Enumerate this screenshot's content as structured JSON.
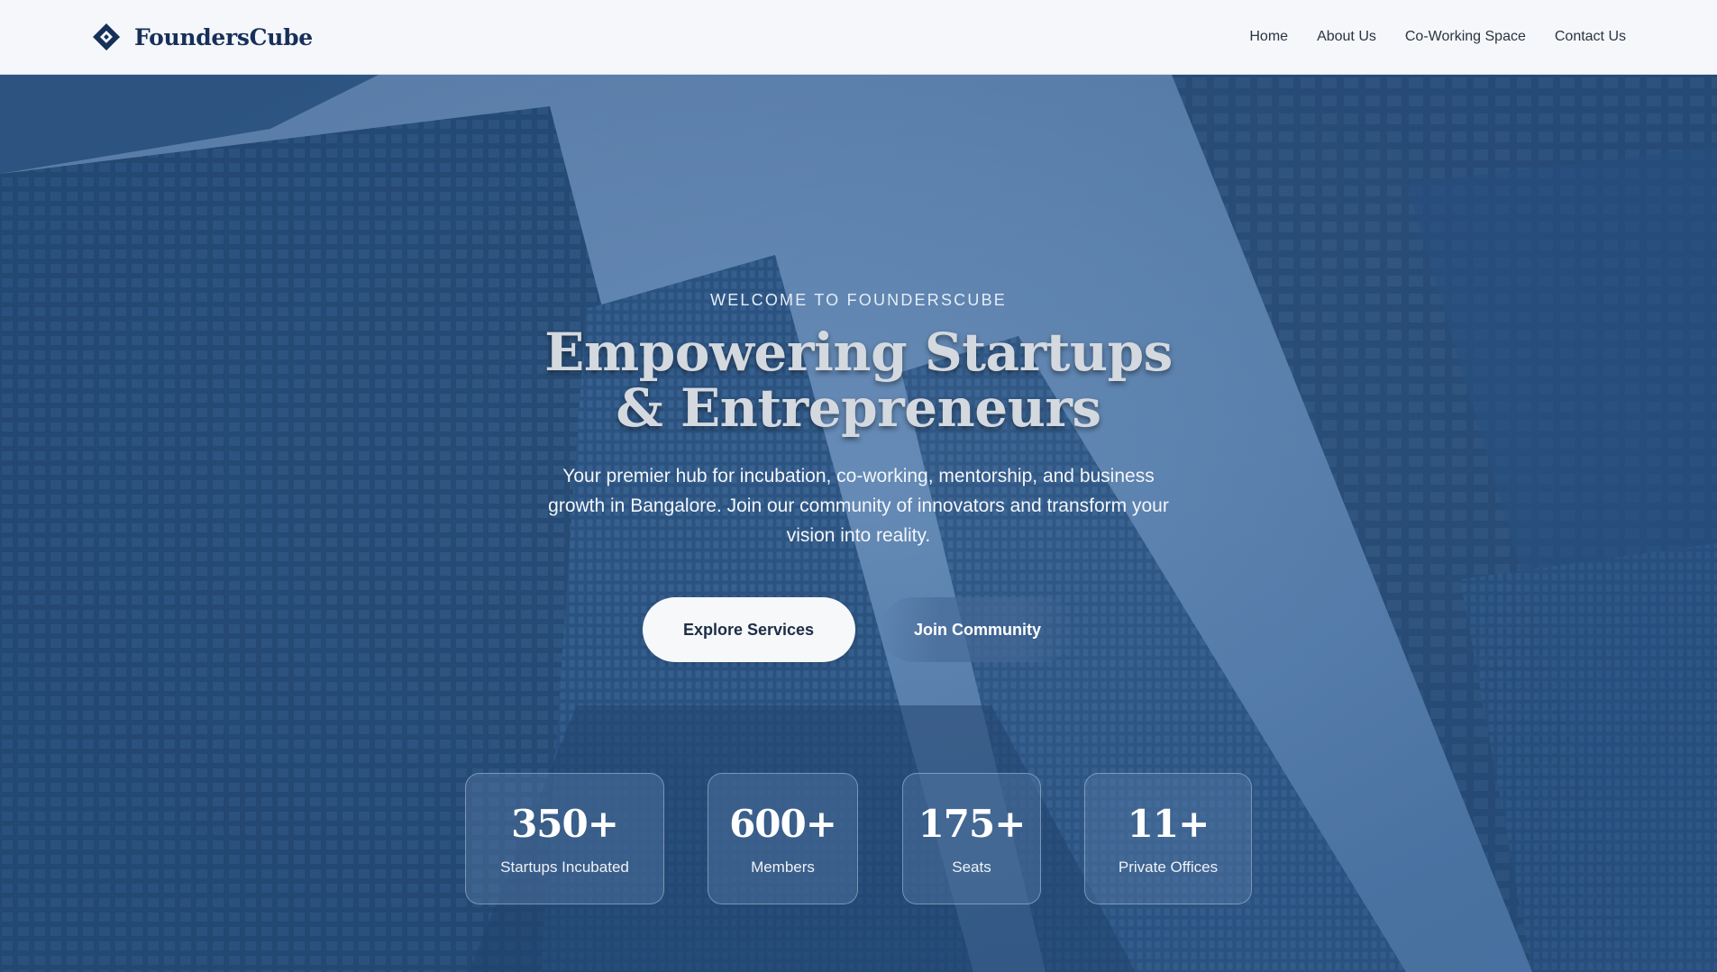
{
  "brand": {
    "name": "FoundersCube",
    "logo_icon": "diamond-logo-icon"
  },
  "nav": {
    "links": [
      "Home",
      "About Us",
      "Co-Working Space",
      "Contact Us"
    ]
  },
  "hero": {
    "eyebrow": "WELCOME TO FOUNDERSCUBE",
    "title": "Empowering Startups & Entrepreneurs",
    "subtitle": "Your premier hub for incubation, co-working, mentorship, and business growth in Bangalore. Join our community of innovators and transform your vision into reality.",
    "primary_cta": "Explore Services",
    "secondary_cta": "Join Community"
  },
  "stats": [
    {
      "value": "350+",
      "label": "Startups Incubated"
    },
    {
      "value": "600+",
      "label": "Members"
    },
    {
      "value": "175+",
      "label": "Seats"
    },
    {
      "value": "11+",
      "label": "Private Offices"
    }
  ],
  "colors": {
    "brand_navy": "#17305a",
    "hero_blue": "#2d5485",
    "nav_bg": "#f5f7fa"
  }
}
